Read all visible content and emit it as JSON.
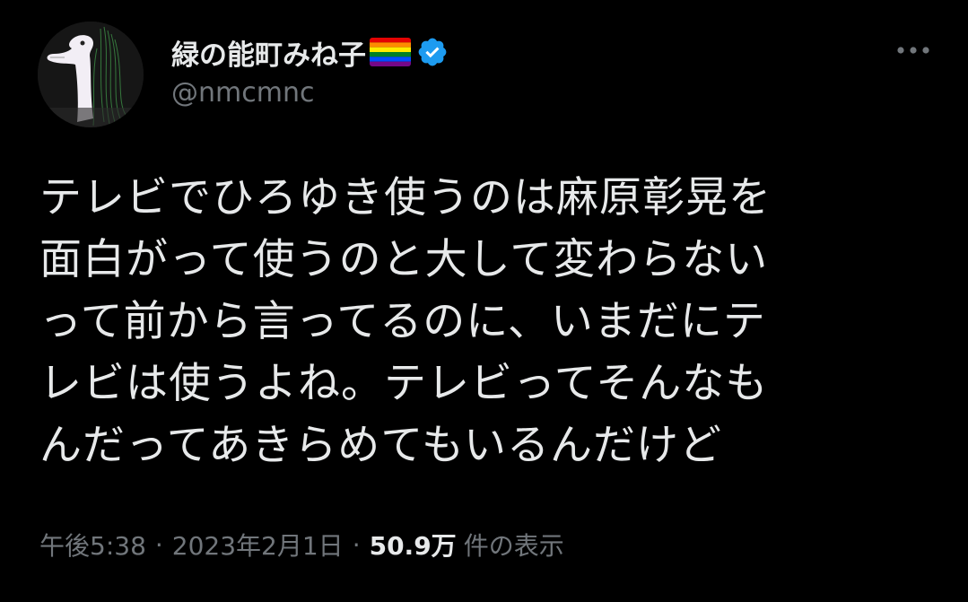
{
  "author": {
    "display_name": "緑の能町みね子",
    "handle": "@nmcmnc",
    "flag_icon": "rainbow-flag-icon",
    "verified_icon": "verified-badge-icon",
    "verified_color": "#1d9bf0"
  },
  "more_icon": "more-horizontal-icon",
  "tweet": {
    "lines": [
      "テレビでひろゆき使うのは麻原彰晃を",
      "面白がって使うのと大して変わらない",
      "って前から言ってるのに、いまだにテ",
      "レビは使うよね。テレビってそんなも",
      "んだってあきらめてもいるんだけど"
    ]
  },
  "meta": {
    "time": "午後5:38",
    "separator": "·",
    "date": "2023年2月1日",
    "views_count": "50.9万",
    "views_label": "件の表示"
  },
  "colors": {
    "background": "#000000",
    "primary_text": "#e7e9ea",
    "secondary_text": "#71767b"
  }
}
